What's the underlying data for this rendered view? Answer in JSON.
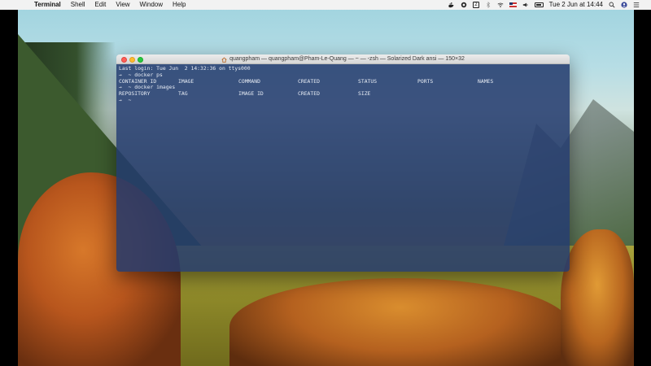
{
  "menubar": {
    "app_name": "Terminal",
    "items": [
      "Shell",
      "Edit",
      "View",
      "Window",
      "Help"
    ],
    "status_badge": "2",
    "datetime": "Tue 2 Jun at  14:44"
  },
  "window": {
    "title": "quangpham — quangpham@Pham-Le-Quang — ~ — -zsh — Solarized Dark ansi — 150×32"
  },
  "terminal": {
    "last_login": "Last login: Tue Jun  2 14:32:36 on ttys000",
    "cmd1_prompt": "→  ~ docker ps",
    "ps_headers": [
      "CONTAINER ID",
      "IMAGE",
      "COMMAND",
      "CREATED",
      "STATUS",
      "PORTS",
      "NAMES"
    ],
    "cmd2_prompt": "→  ~ docker images",
    "images_headers": [
      "REPOSITORY",
      "TAG",
      "IMAGE ID",
      "CREATED",
      "SIZE"
    ],
    "current_prompt": "→  ~"
  },
  "colors": {
    "terminal_bg": "#233a6e",
    "close": "#ff5f57",
    "minimize": "#febc2e",
    "maximize": "#28c840"
  }
}
